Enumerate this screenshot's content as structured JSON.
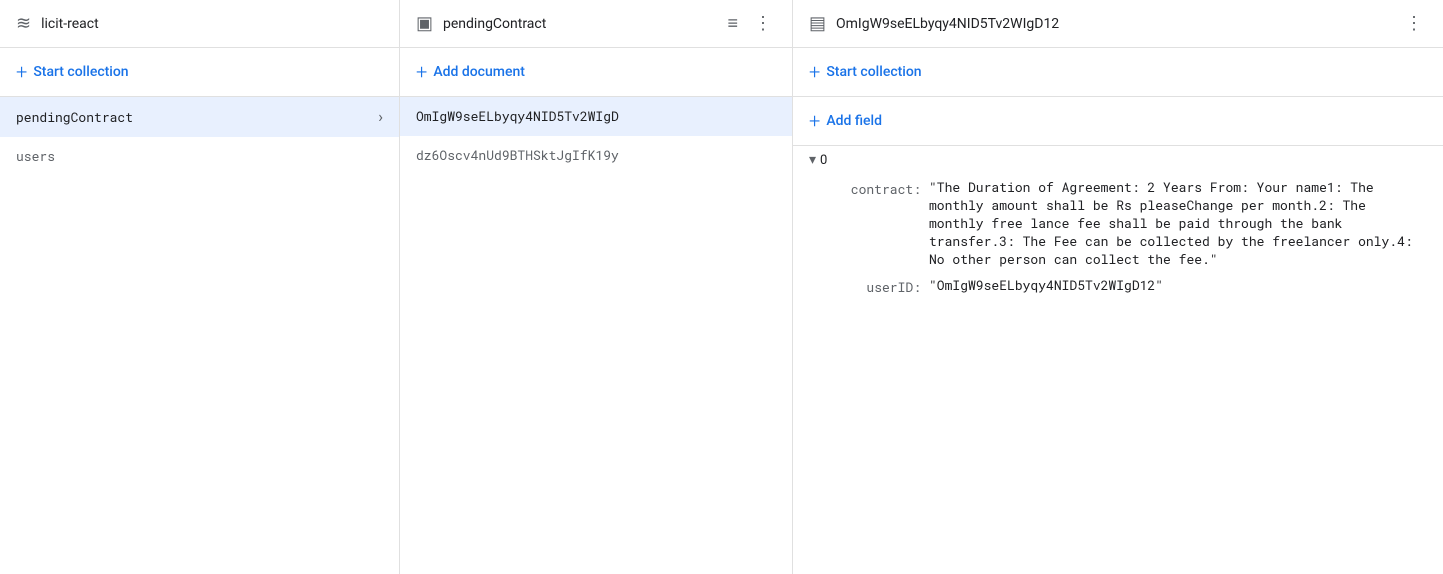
{
  "panels": {
    "col1": {
      "icon": "wifi-icon",
      "title": "licit-react",
      "start_collection_label": "Start collection",
      "items": [
        {
          "id": "pendingContract",
          "label": "pendingContract",
          "active": true
        },
        {
          "id": "users",
          "label": "users",
          "active": false
        }
      ]
    },
    "col2": {
      "icon": "document-icon",
      "title": "pendingContract",
      "add_document_label": "Add document",
      "items": [
        {
          "id": "doc1",
          "label": "OmIgW9seELbyqy4NID5Tv2WIgD"
        },
        {
          "id": "doc2",
          "label": "dz6Oscv4nUd9BTHSktJgIfK19y"
        }
      ]
    },
    "col3": {
      "icon": "document-text-icon",
      "title": "OmIgW9seELbyqy4NID5Tv2WIgD12",
      "start_collection_label": "Start collection",
      "add_field_label": "Add field",
      "expand_label": "0",
      "fields": [
        {
          "key": "contract:",
          "value": "\"The Duration of Agreement: 2 Years From: Your name1: The monthly amount shall be Rs pleaseChange per month.2: The monthly free lance fee shall be paid through the bank transfer.3: The Fee can be collected by the freelancer only.4: No other person can collect the fee.\""
        },
        {
          "key": "userID:",
          "value": "\"OmIgW9seELbyqy4NID5Tv2WIgD12\""
        }
      ]
    }
  },
  "icons": {
    "wifi": "≋",
    "document": "▣",
    "document_text": "▤",
    "filter": "≡",
    "more_vert": "⋮",
    "plus": "+",
    "chevron_right": "›",
    "chevron_down": "▾"
  }
}
